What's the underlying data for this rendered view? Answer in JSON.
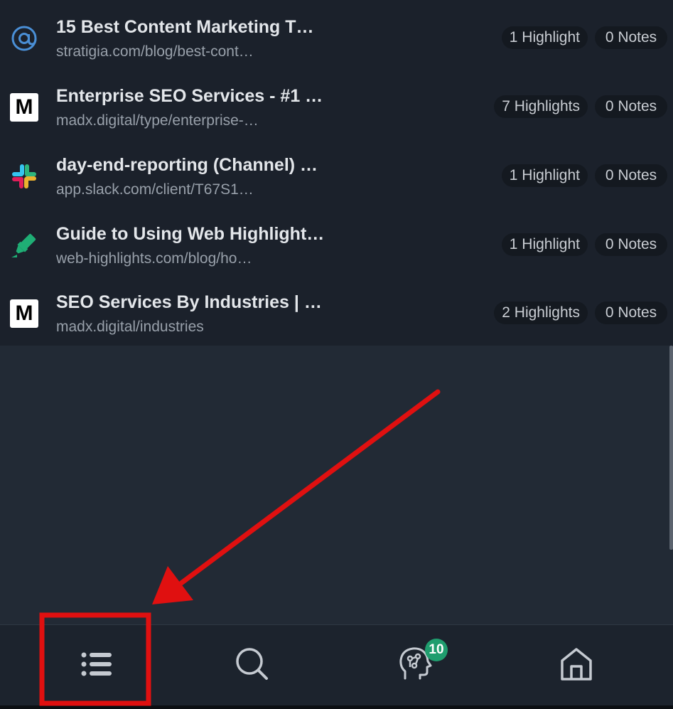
{
  "items": [
    {
      "title": "15 Best Content Marketing T…",
      "url": "stratigia.com/blog/best-cont…",
      "highlights": "1 Highlight",
      "notes": "0 Notes",
      "icon": "at-sign-icon"
    },
    {
      "title": "Enterprise SEO Services - #1 …",
      "url": "madx.digital/type/enterprise-…",
      "highlights": "7 Highlights",
      "notes": "0 Notes",
      "icon": "m-logo-icon",
      "icon_letter": "M"
    },
    {
      "title": "day-end-reporting (Channel) …",
      "url": "app.slack.com/client/T67S1…",
      "highlights": "1 Highlight",
      "notes": "0 Notes",
      "icon": "slack-logo-icon"
    },
    {
      "title": "Guide to Using Web Highlight…",
      "url": "web-highlights.com/blog/ho…",
      "highlights": "1 Highlight",
      "notes": "0 Notes",
      "icon": "highlighter-icon"
    },
    {
      "title": "SEO Services By Industries | …",
      "url": "madx.digital/industries",
      "highlights": "2 Highlights",
      "notes": "0 Notes",
      "icon": "m-logo-icon",
      "icon_letter": "M"
    }
  ],
  "nav": {
    "items": [
      {
        "icon": "list-icon"
      },
      {
        "icon": "search-icon"
      },
      {
        "icon": "brain-head-icon",
        "badge": "10"
      },
      {
        "icon": "home-icon"
      }
    ]
  },
  "colors": {
    "background": "#222a35",
    "list_background": "#1b212b",
    "badge": "#1f9d6e",
    "annotation": "#e01010",
    "slack": [
      "#36c5f0",
      "#2eb67d",
      "#ecb22e",
      "#e01e5a"
    ],
    "highlighter": "#1fae75",
    "at_sign": "#4a8fd6"
  }
}
